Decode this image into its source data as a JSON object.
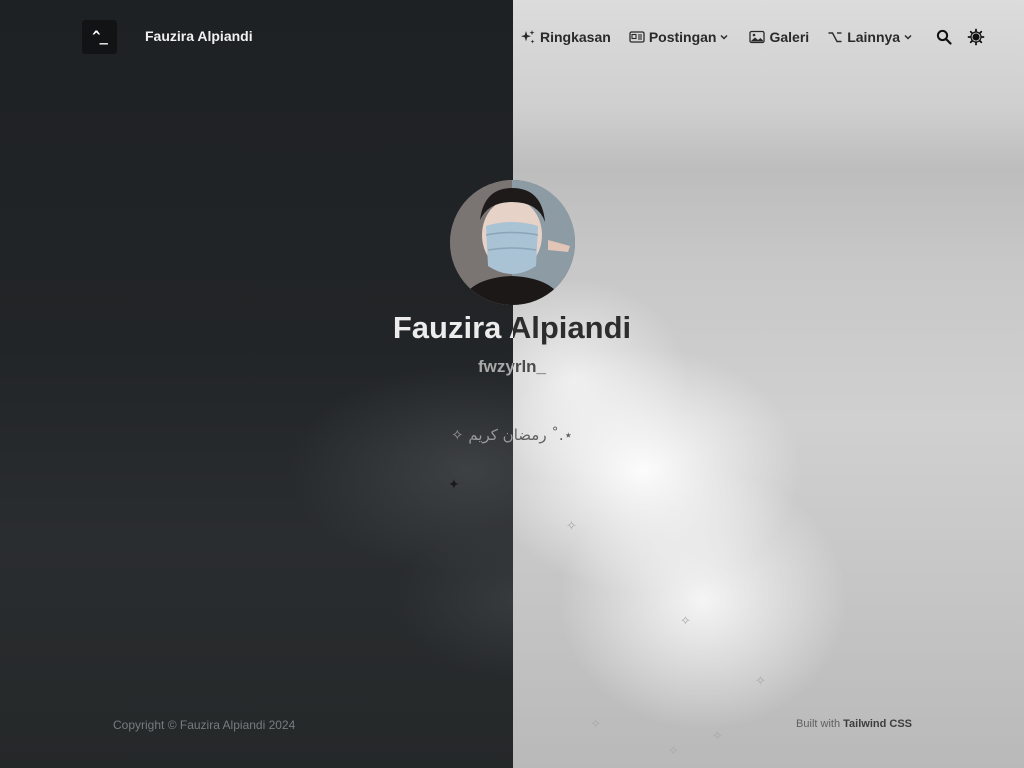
{
  "header": {
    "logo_text": "^_",
    "site_name": "Fauzira Alpiandi"
  },
  "nav": {
    "items": [
      {
        "label": "Ringkasan",
        "icon": "sparkles-icon"
      },
      {
        "label": "Postingan",
        "icon": "newspaper-icon",
        "has_dropdown": true
      },
      {
        "label": "Galeri",
        "icon": "photo-icon"
      },
      {
        "label": "Lainnya",
        "icon": "option-key-icon",
        "has_dropdown": true
      }
    ],
    "search_icon": "search-icon",
    "theme_icon": "sun-icon"
  },
  "hero": {
    "name": "Fauzira Alpiandi",
    "handle": "fwzyrln_",
    "bio": "✧ رمضان كريم ˚.⋆"
  },
  "footer": {
    "copyright": "Copyright © Fauzira Alpiandi 2024",
    "built_with_prefix": "Built with",
    "built_with_tool": "Tailwind CSS"
  },
  "colors": {
    "dark_half": "#1e2123",
    "light_half": "#cfcfcf",
    "text_dark": "#2a2a2a",
    "text_light": "#f1f1f1"
  }
}
